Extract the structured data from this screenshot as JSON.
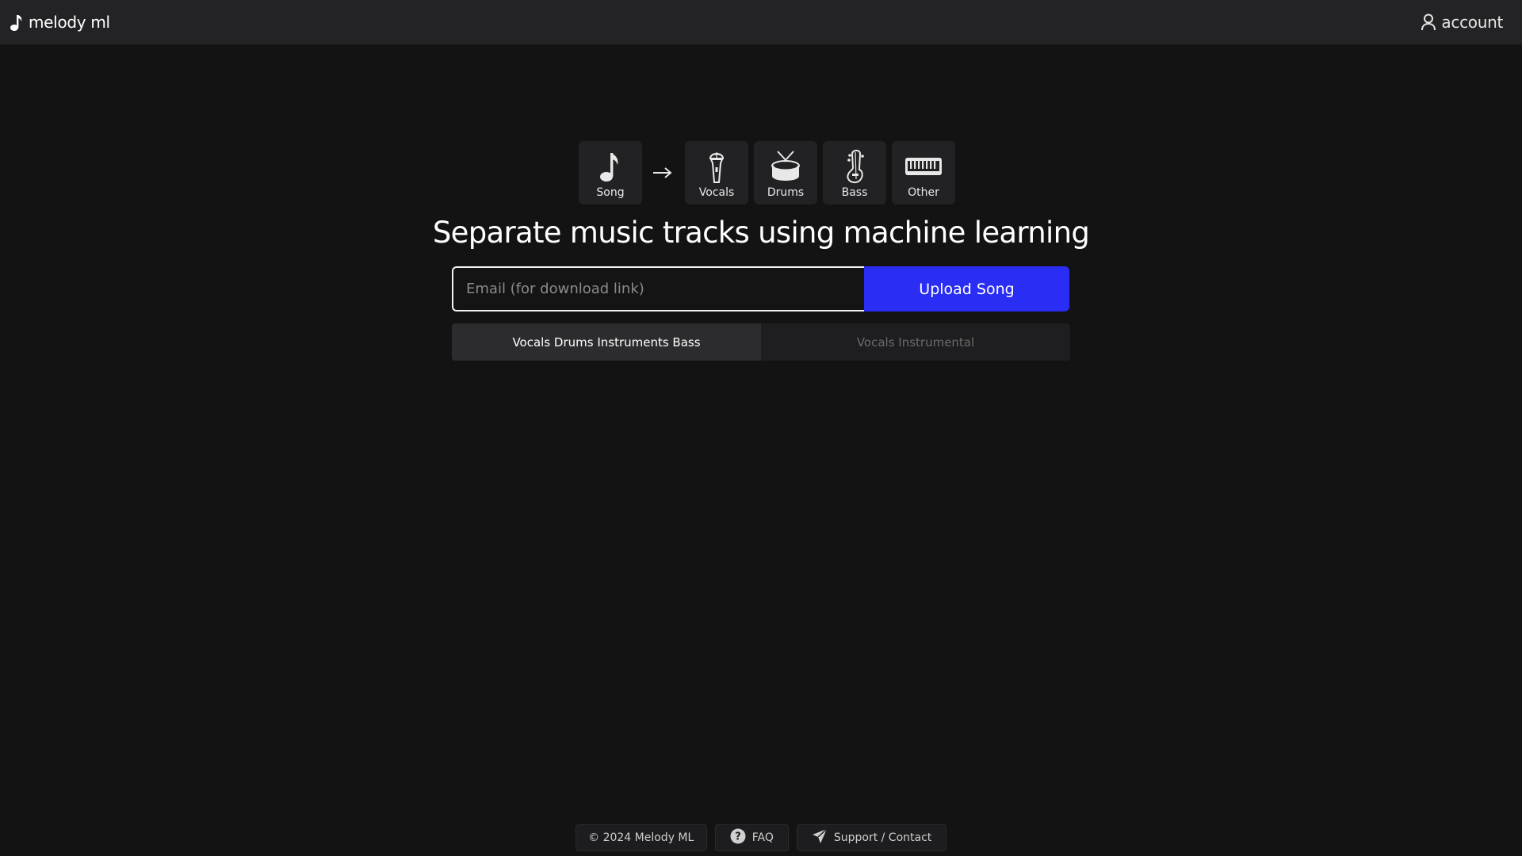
{
  "header": {
    "brand_name": "melody ml",
    "brand_icon": "music-note-icon",
    "account_label": "account",
    "account_icon": "user-icon"
  },
  "stems": {
    "source": {
      "label": "Song",
      "icon": "music-note-icon"
    },
    "arrow_icon": "arrow-right-icon",
    "outputs": [
      {
        "label": "Vocals",
        "icon": "microphone-icon"
      },
      {
        "label": "Drums",
        "icon": "drum-icon"
      },
      {
        "label": "Bass",
        "icon": "bass-guitar-icon"
      },
      {
        "label": "Other",
        "icon": "keyboard-icon"
      }
    ]
  },
  "main": {
    "headline": "Separate music tracks using machine learning",
    "email_placeholder": "Email (for download link)",
    "email_value": "",
    "upload_label": "Upload Song"
  },
  "modes": [
    {
      "label": "Vocals Drums Instruments Bass",
      "selected": true
    },
    {
      "label": "Vocals Instrumental",
      "selected": false
    }
  ],
  "footer": {
    "copyright": "© 2024 Melody ML",
    "faq_label": "FAQ",
    "faq_icon": "question-circle-icon",
    "support_label": "Support / Contact",
    "support_icon": "paper-plane-icon"
  },
  "colors": {
    "background": "#131313",
    "topbar": "#232325",
    "tile": "#222224",
    "accent": "#2a2ef5"
  }
}
